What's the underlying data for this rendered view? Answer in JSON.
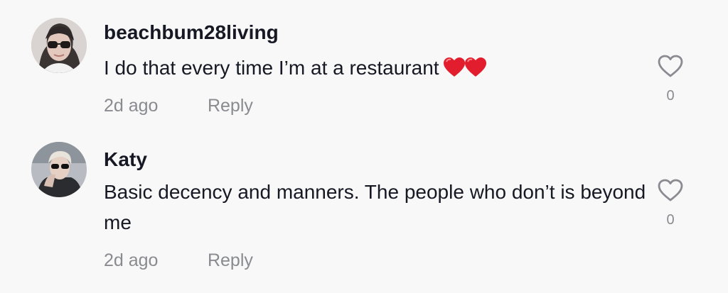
{
  "comments": [
    {
      "username": "beachbum28living",
      "text": "I do that every time I’m at a restaurant",
      "emoji": "red-heart-icon",
      "age": "2d ago",
      "reply_label": "Reply",
      "like_count": "0"
    },
    {
      "username": "Katy",
      "text": "Basic decency and manners. The people who don’t is beyond me",
      "age": "2d ago",
      "reply_label": "Reply",
      "like_count": "0"
    }
  ],
  "colors": {
    "background": "#f8f8f8",
    "primary_text": "#161823",
    "secondary_text": "#8a8b91",
    "heart_emoji": "#e11d2e"
  }
}
